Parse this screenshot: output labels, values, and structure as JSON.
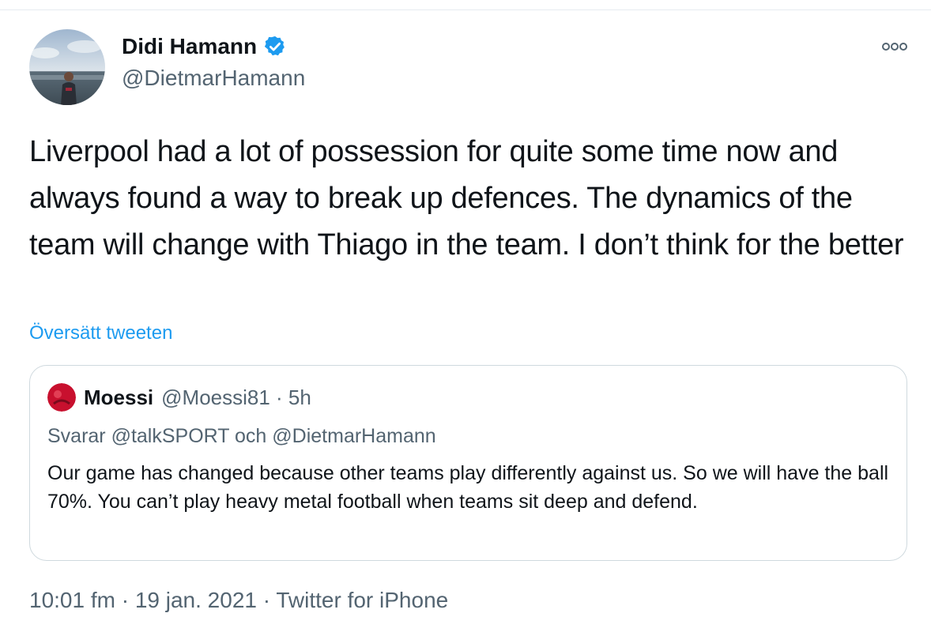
{
  "tweet": {
    "author_name": "Didi Hamann",
    "author_handle": "@DietmarHamann",
    "text": "Liverpool had a lot of possession for quite some time now and always found a way to break up defences. The dynamics of the team will change with Thiago in the team. I don’t think for the better",
    "translate_label": "Översätt tweeten",
    "footer_meta": "10:01 fm · 19 jan. 2021 · Twitter for iPhone",
    "verified_badge": "verified-icon",
    "more_options": "more-icon"
  },
  "quote": {
    "author_name": "Moessi",
    "meta": "@Moessi81 · 5h",
    "reply_context": "Svarar @talkSPORT och @DietmarHamann",
    "text": "Our game has changed because other teams play differently against us. So we will have the ball 70%. You can’t play heavy metal football when teams sit deep and defend."
  },
  "colors": {
    "accent": "#1d9bf0",
    "secondary_text": "#536471",
    "border": "#cfd9de"
  }
}
